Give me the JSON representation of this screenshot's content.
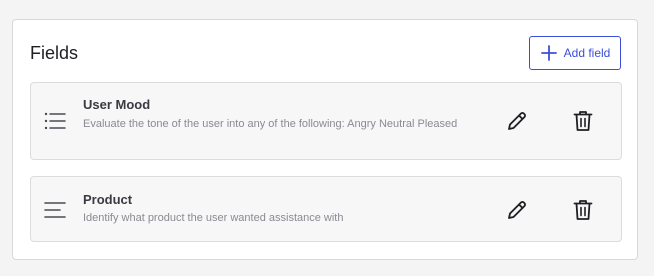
{
  "panel": {
    "title": "Fields",
    "add_button": {
      "label": "Add field",
      "icon": "plus-icon",
      "accent_color": "#3b4fd8"
    }
  },
  "fields": [
    {
      "name": "User Mood",
      "description": "Evaluate the tone of the user into any of the following: Angry Neutral Pleased",
      "type_icon": "list-icon",
      "actions": [
        "edit-icon",
        "trash-icon"
      ]
    },
    {
      "name": "Product",
      "description": "Identify what product the user wanted assistance with",
      "type_icon": "text-lines-icon",
      "actions": [
        "edit-icon",
        "trash-icon"
      ]
    }
  ]
}
